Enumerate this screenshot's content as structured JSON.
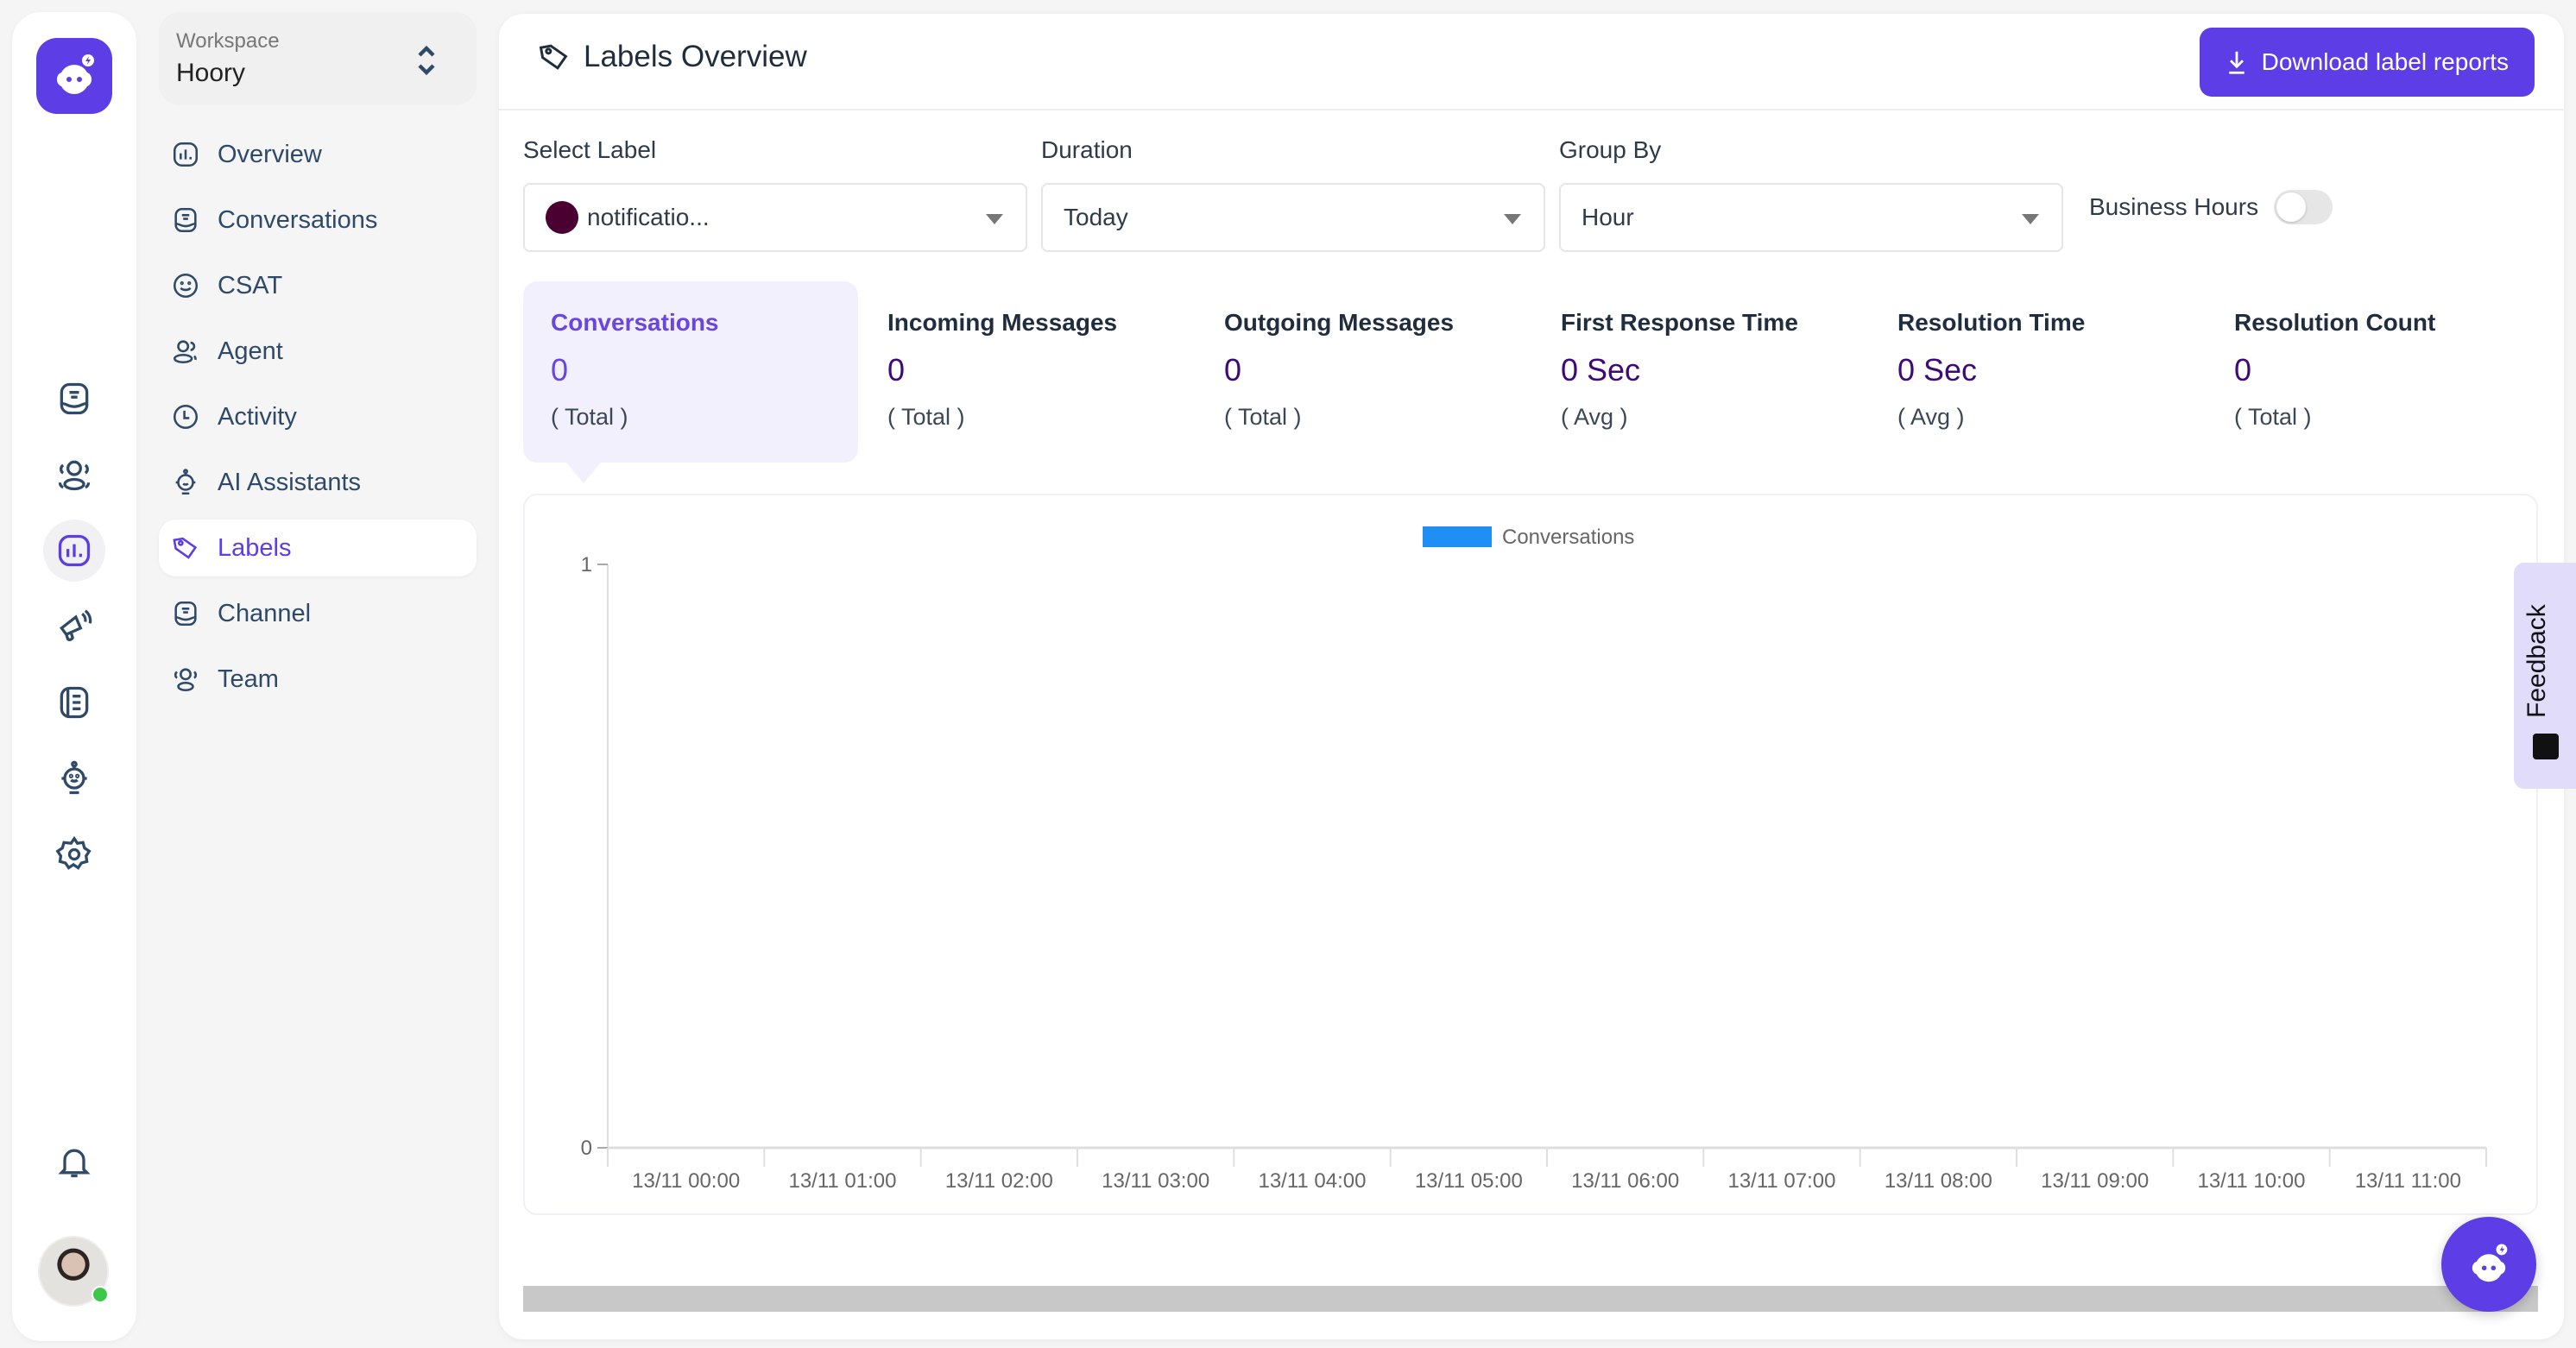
{
  "rail": {
    "icons": [
      {
        "name": "conversations-icon",
        "active": false
      },
      {
        "name": "contacts-icon",
        "active": false
      },
      {
        "name": "reports-icon",
        "active": true
      },
      {
        "name": "campaigns-icon",
        "active": false
      },
      {
        "name": "library-icon",
        "active": false
      },
      {
        "name": "ai-assistant-icon",
        "active": false
      },
      {
        "name": "settings-icon",
        "active": false
      }
    ],
    "notifications_icon": "bell-icon",
    "avatar_status": "online"
  },
  "workspace": {
    "label": "Workspace",
    "name": "Hoory"
  },
  "nav": {
    "items": [
      {
        "label": "Overview",
        "icon": "chart-icon"
      },
      {
        "label": "Conversations",
        "icon": "inbox-icon"
      },
      {
        "label": "CSAT",
        "icon": "smile-icon"
      },
      {
        "label": "Agent",
        "icon": "users-icon"
      },
      {
        "label": "Activity",
        "icon": "clock-icon"
      },
      {
        "label": "AI Assistants",
        "icon": "robot-icon"
      },
      {
        "label": "Labels",
        "icon": "tag-icon",
        "active": true
      },
      {
        "label": "Channel",
        "icon": "inbox-icon"
      },
      {
        "label": "Team",
        "icon": "team-icon"
      }
    ]
  },
  "header": {
    "title": "Labels Overview",
    "download_label": "Download label reports"
  },
  "filters": {
    "select_label": {
      "label": "Select Label",
      "value": "notificatio...",
      "color": "#4a0030"
    },
    "duration": {
      "label": "Duration",
      "value": "Today"
    },
    "group_by": {
      "label": "Group By",
      "value": "Hour"
    },
    "business_hours": {
      "label": "Business Hours",
      "enabled": false
    }
  },
  "metrics": [
    {
      "title": "Conversations",
      "value": "0",
      "sub": "( Total )",
      "active": true
    },
    {
      "title": "Incoming Messages",
      "value": "0",
      "sub": "( Total )"
    },
    {
      "title": "Outgoing Messages",
      "value": "0",
      "sub": "( Total )"
    },
    {
      "title": "First Response Time",
      "value": "0 Sec",
      "sub": "( Avg )"
    },
    {
      "title": "Resolution Time",
      "value": "0 Sec",
      "sub": "( Avg )"
    },
    {
      "title": "Resolution Count",
      "value": "0",
      "sub": "( Total )"
    }
  ],
  "chart_data": {
    "type": "bar",
    "title": "",
    "xlabel": "",
    "ylabel": "",
    "legend": {
      "position": "top-center",
      "entries": [
        {
          "name": "Conversations",
          "color": "#1f8ff5"
        }
      ]
    },
    "categories": [
      "13/11 00:00",
      "13/11 01:00",
      "13/11 02:00",
      "13/11 03:00",
      "13/11 04:00",
      "13/11 05:00",
      "13/11 06:00",
      "13/11 07:00",
      "13/11 08:00",
      "13/11 09:00",
      "13/11 10:00",
      "13/11 11:00"
    ],
    "series": [
      {
        "name": "Conversations",
        "values": [
          0,
          0,
          0,
          0,
          0,
          0,
          0,
          0,
          0,
          0,
          0,
          0
        ]
      }
    ],
    "ylim": [
      0,
      1
    ],
    "yticks": [
      "0",
      "1"
    ],
    "grid": false
  },
  "feedback": {
    "label": "Feedback"
  }
}
